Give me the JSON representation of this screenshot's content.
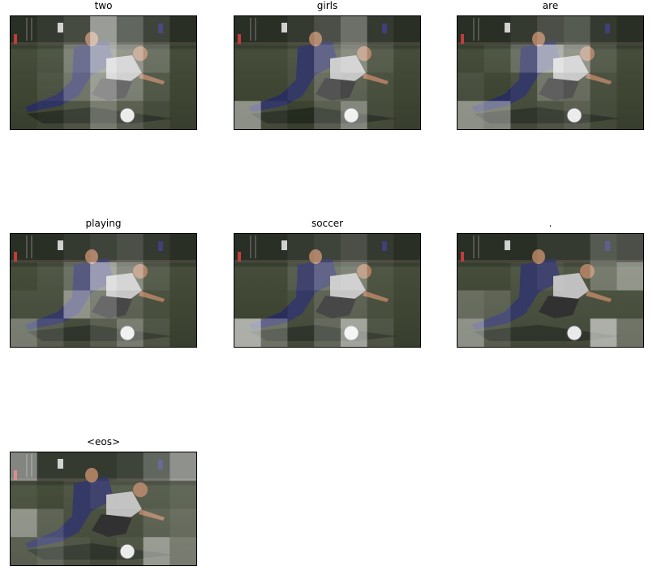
{
  "panels": [
    {
      "title": "two",
      "attention": [
        [
          0.05,
          0.1,
          0.18,
          0.55,
          0.3,
          0.15,
          0.05
        ],
        [
          0.05,
          0.1,
          0.35,
          0.6,
          0.45,
          0.25,
          0.05
        ],
        [
          0.05,
          0.12,
          0.3,
          0.5,
          0.35,
          0.15,
          0.05
        ],
        [
          0.05,
          0.08,
          0.15,
          0.35,
          0.2,
          0.1,
          0.05
        ]
      ]
    },
    {
      "title": "girls",
      "attention": [
        [
          0.05,
          0.05,
          0.1,
          0.2,
          0.35,
          0.1,
          0.05
        ],
        [
          0.05,
          0.05,
          0.1,
          0.3,
          0.4,
          0.15,
          0.05
        ],
        [
          0.05,
          0.05,
          0.1,
          0.25,
          0.2,
          0.1,
          0.05
        ],
        [
          0.45,
          0.1,
          0.05,
          0.2,
          0.4,
          0.1,
          0.05
        ]
      ]
    },
    {
      "title": "are",
      "attention": [
        [
          0.05,
          0.05,
          0.1,
          0.2,
          0.25,
          0.1,
          0.05
        ],
        [
          0.05,
          0.1,
          0.25,
          0.6,
          0.45,
          0.15,
          0.05
        ],
        [
          0.1,
          0.05,
          0.1,
          0.3,
          0.25,
          0.1,
          0.05
        ],
        [
          0.45,
          0.4,
          0.1,
          0.15,
          0.2,
          0.1,
          0.05
        ]
      ]
    },
    {
      "title": "playing",
      "attention": [
        [
          0.05,
          0.05,
          0.1,
          0.15,
          0.2,
          0.1,
          0.05
        ],
        [
          0.05,
          0.1,
          0.25,
          0.55,
          0.4,
          0.15,
          0.05
        ],
        [
          0.1,
          0.1,
          0.45,
          0.35,
          0.2,
          0.1,
          0.05
        ],
        [
          0.35,
          0.2,
          0.1,
          0.2,
          0.35,
          0.15,
          0.05
        ]
      ]
    },
    {
      "title": "soccer",
      "attention": [
        [
          0.05,
          0.05,
          0.1,
          0.15,
          0.2,
          0.1,
          0.05
        ],
        [
          0.05,
          0.05,
          0.15,
          0.3,
          0.35,
          0.1,
          0.05
        ],
        [
          0.05,
          0.05,
          0.1,
          0.2,
          0.2,
          0.1,
          0.05
        ],
        [
          0.6,
          0.3,
          0.1,
          0.25,
          0.55,
          0.15,
          0.05
        ]
      ]
    },
    {
      "title": ".",
      "attention": [
        [
          0.05,
          0.05,
          0.05,
          0.1,
          0.1,
          0.25,
          0.2
        ],
        [
          0.05,
          0.05,
          0.1,
          0.15,
          0.1,
          0.3,
          0.45
        ],
        [
          0.25,
          0.2,
          0.1,
          0.1,
          0.1,
          0.1,
          0.1
        ],
        [
          0.45,
          0.2,
          0.1,
          0.1,
          0.1,
          0.6,
          0.3
        ]
      ]
    },
    {
      "title": "<eos>",
      "attention": [
        [
          0.45,
          0.1,
          0.1,
          0.1,
          0.15,
          0.3,
          0.5
        ],
        [
          0.1,
          0.05,
          0.1,
          0.15,
          0.15,
          0.15,
          0.2
        ],
        [
          0.45,
          0.2,
          0.1,
          0.1,
          0.1,
          0.2,
          0.25
        ],
        [
          0.2,
          0.25,
          0.15,
          0.1,
          0.15,
          0.5,
          0.35
        ]
      ]
    }
  ]
}
